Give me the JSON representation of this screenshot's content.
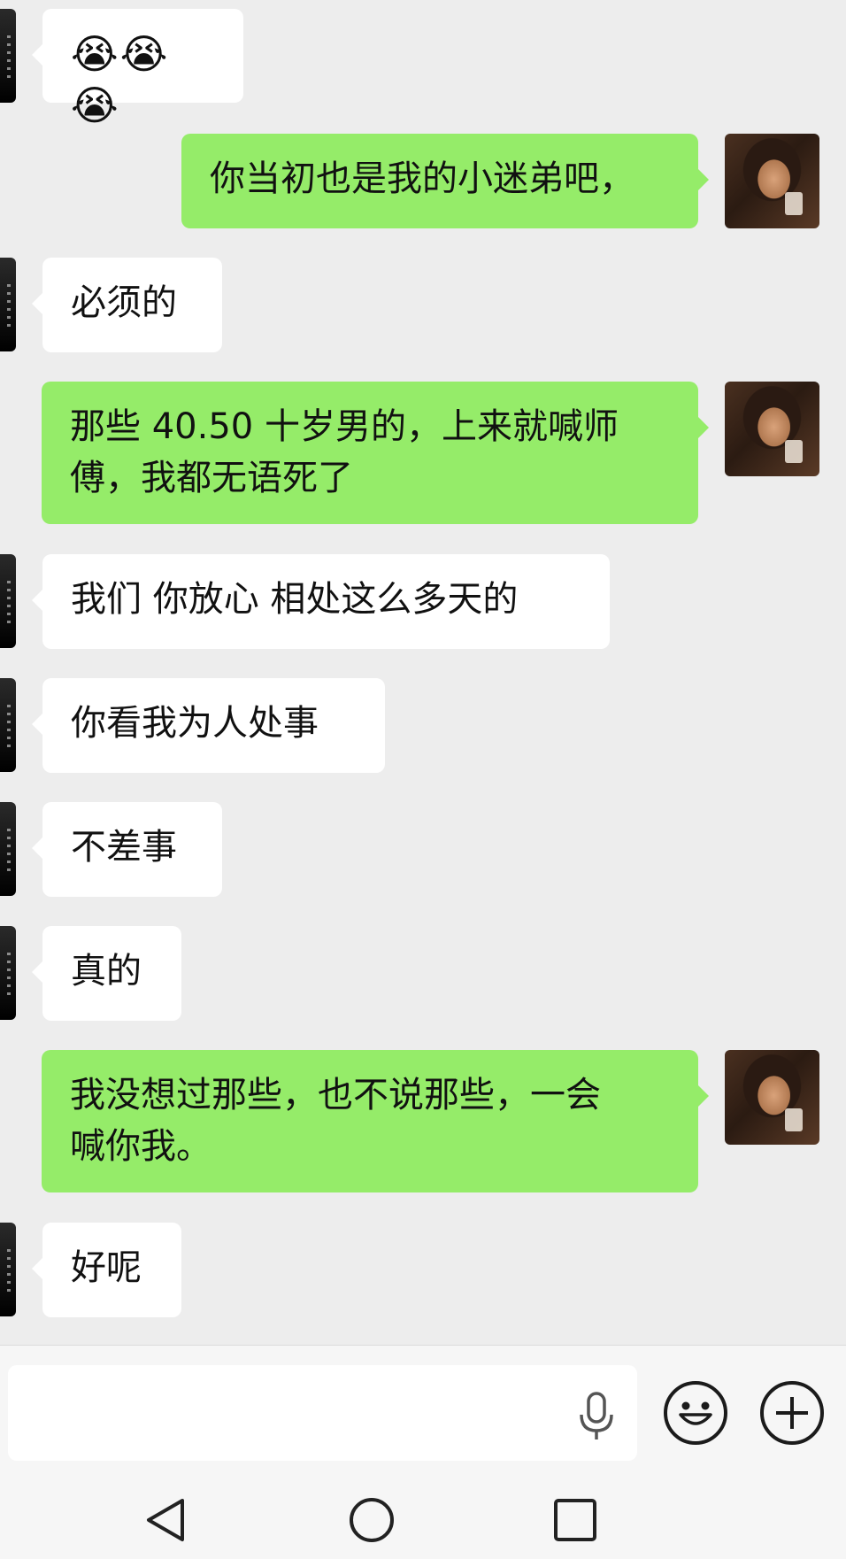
{
  "messages": [
    {
      "side": "in",
      "text": "😭😭😭"
    },
    {
      "side": "out",
      "text": "你当初也是我的小迷弟吧，"
    },
    {
      "side": "in",
      "text": "必须的"
    },
    {
      "side": "out",
      "line1": "那些 40.50 十岁男的，上来就喊师",
      "line2": "傅，我都无语死了"
    },
    {
      "side": "in",
      "text": "我们 你放心 相处这么多天的"
    },
    {
      "side": "in",
      "text": "你看我为人处事"
    },
    {
      "side": "in",
      "text": "不差事"
    },
    {
      "side": "in",
      "text": "真的"
    },
    {
      "side": "out",
      "line1": "我没想过那些，也不说那些，一会",
      "line2": "喊你我。"
    },
    {
      "side": "in",
      "text": "好呢"
    }
  ],
  "input": {
    "value": "",
    "placeholder": ""
  },
  "icons": {
    "voice": "microphone-icon",
    "emoji": "smiley-icon",
    "more": "plus-icon",
    "back": "back-triangle-icon",
    "home": "home-circle-icon",
    "recents": "recents-square-icon"
  },
  "colors": {
    "outgoing_bubble": "#95ec69",
    "incoming_bubble": "#ffffff",
    "background": "#ededed"
  }
}
